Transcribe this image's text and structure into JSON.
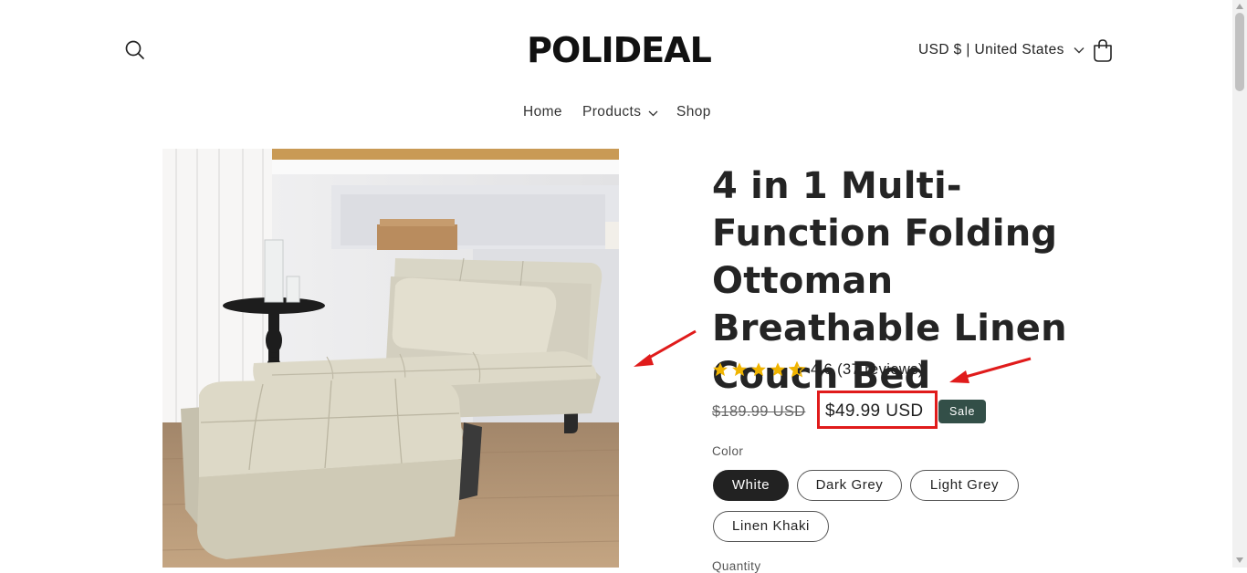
{
  "header": {
    "logo": "POLIDEAL",
    "currency_label": "USD $ | United States"
  },
  "nav": {
    "items": [
      "Home",
      "Products",
      "Shop"
    ]
  },
  "product": {
    "title": "4 in 1 Multi-Function Folding Ottoman Breathable Linen Couch Bed",
    "rating_value": 4.6,
    "rating_text": "4.6 (37 reviews)",
    "compare_price": "$189.99 USD",
    "sale_price": "$49.99 USD",
    "sale_badge": "Sale",
    "color_label": "Color",
    "colors": [
      "White",
      "Dark Grey",
      "Light Grey",
      "Linen Khaki"
    ],
    "selected_color": "White",
    "quantity_label": "Quantity"
  },
  "colors": {
    "accent_red": "#e01b1b",
    "sale_badge_bg": "#334f48",
    "star": "#f0b400",
    "selected_swatch": "#222222"
  },
  "icons": [
    "search-icon",
    "cart-icon",
    "chevron-down-icon",
    "star-icon"
  ]
}
